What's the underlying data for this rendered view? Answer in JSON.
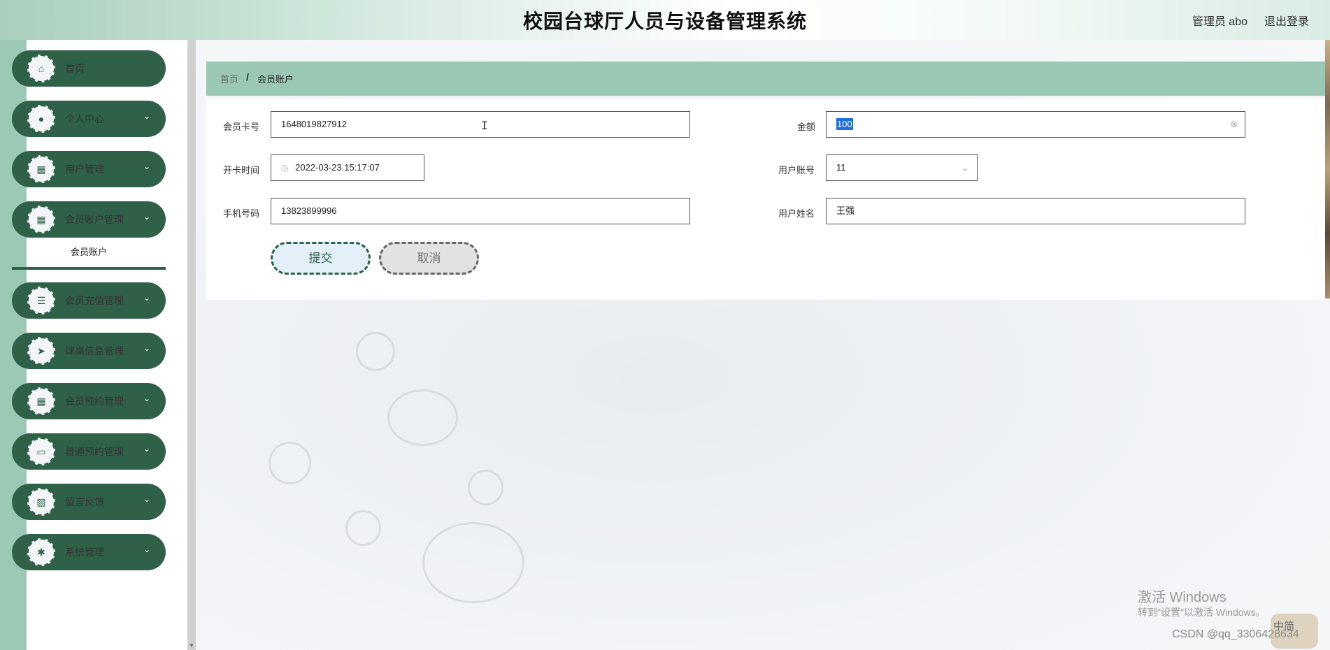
{
  "header": {
    "title": "校园台球厅人员与设备管理系统",
    "user_label": "管理员 abo",
    "logout_label": "退出登录"
  },
  "sidebar": {
    "items": [
      {
        "label": "首页",
        "icon": "home-icon",
        "has_children": false
      },
      {
        "label": "个人中心",
        "icon": "user-icon",
        "has_children": true
      },
      {
        "label": "用户管理",
        "icon": "grid-icon",
        "has_children": true
      },
      {
        "label": "会员账户管理",
        "icon": "grid-icon",
        "has_children": true
      },
      {
        "label": "会员充值管理",
        "icon": "list-icon",
        "has_children": true
      },
      {
        "label": "球桌信息管理",
        "icon": "send-icon",
        "has_children": true
      },
      {
        "label": "会员预约管理",
        "icon": "grid-icon",
        "has_children": true
      },
      {
        "label": "普通预约管理",
        "icon": "monitor-icon",
        "has_children": true
      },
      {
        "label": "留言反馈",
        "icon": "chart-icon",
        "has_children": true
      },
      {
        "label": "系统管理",
        "icon": "cogs-icon",
        "has_children": true
      }
    ],
    "submenu_active": "会员账户"
  },
  "breadcrumb": {
    "home": "首页",
    "separator": "/",
    "current": "会员账户"
  },
  "form": {
    "card_no_label": "会员卡号",
    "card_no_value": "1648019827912",
    "amount_label": "金额",
    "amount_value": "100",
    "open_time_label": "开卡时间",
    "open_time_value": "2022-03-23 15:17:07",
    "user_account_label": "用户账号",
    "user_account_value": "11",
    "phone_label": "手机号码",
    "phone_value": "13823899996",
    "user_name_label": "用户姓名",
    "user_name_value": "王强"
  },
  "buttons": {
    "submit": "提交",
    "cancel": "取消"
  },
  "overlay": {
    "activate_title": "激活 Windows",
    "activate_hint": "转到\"设置\"以激活 Windows。",
    "csdn_mark": "CSDN @qq_3306428634",
    "ime_label": "中简"
  },
  "colors": {
    "sidebar_button": "#2f6148",
    "breadcrumb_bar": "#9bc8b5",
    "selection": "#1e6fd9"
  }
}
